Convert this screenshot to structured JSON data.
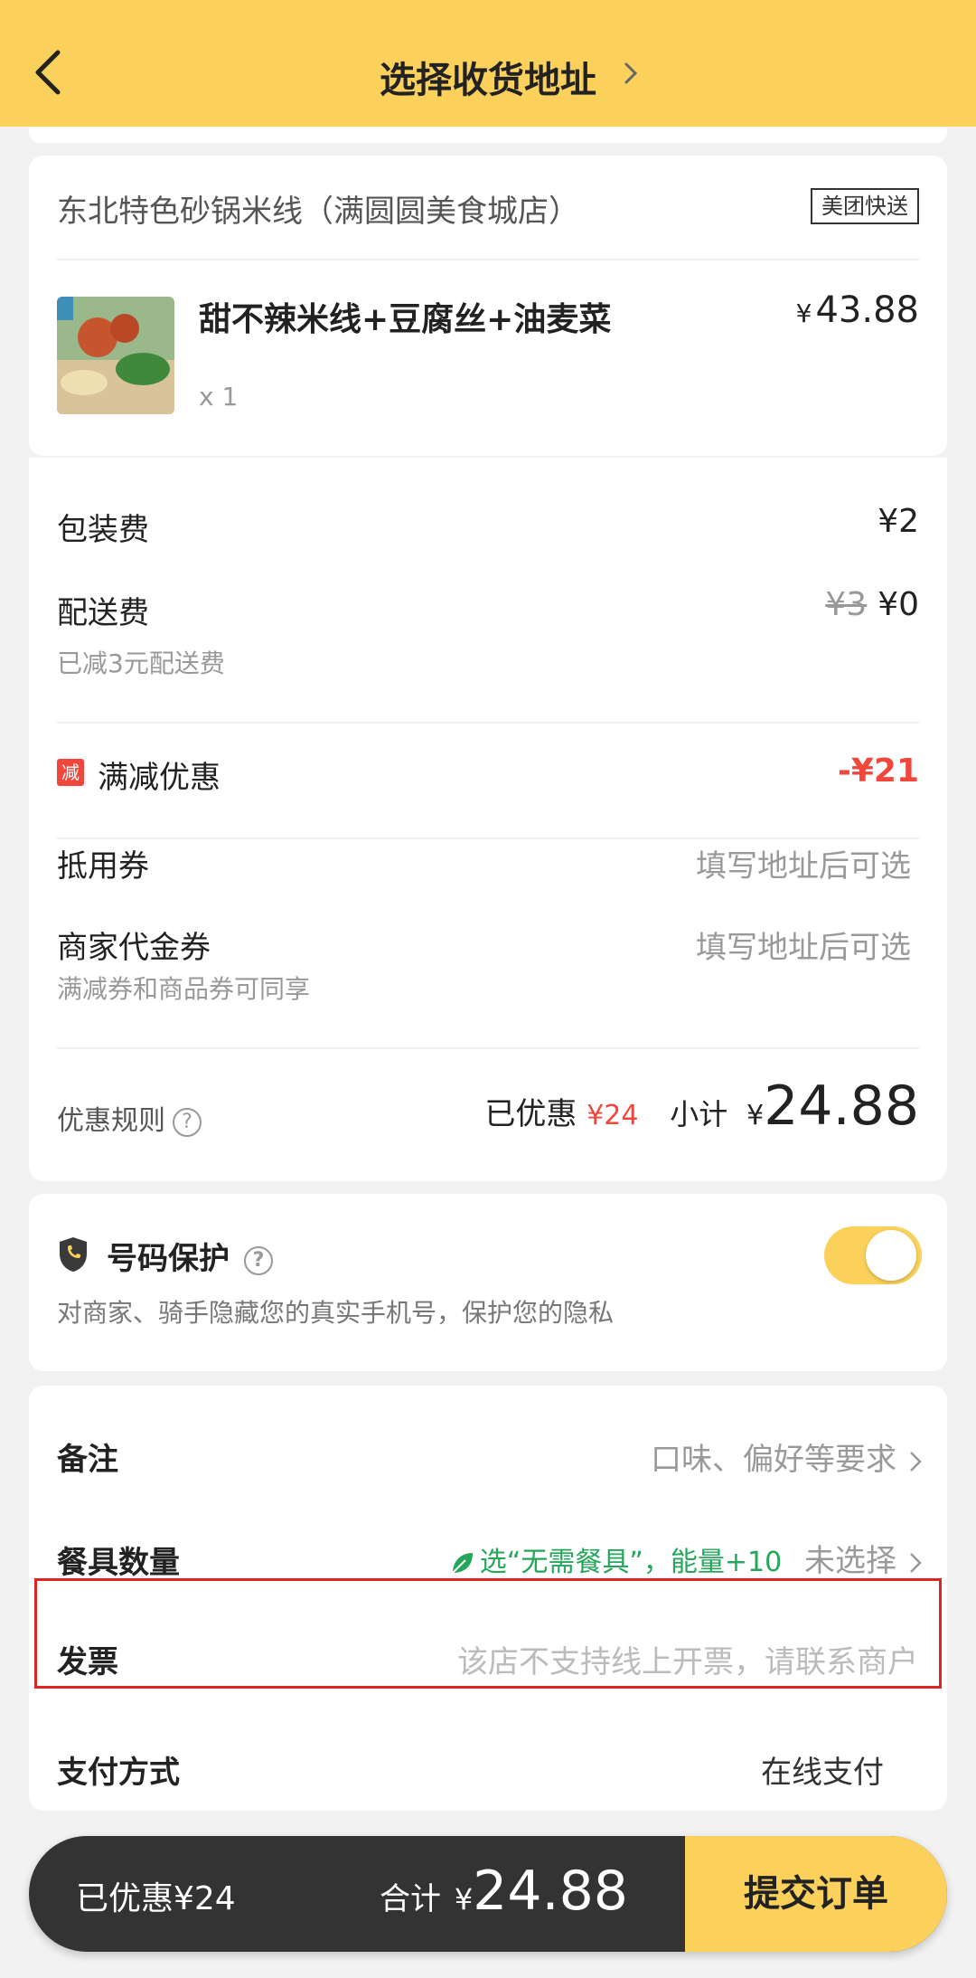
{
  "header": {
    "title": "选择收货地址"
  },
  "shop": {
    "name": "东北特色砂锅米线（满圆圆美食城店）",
    "badge": "美团快送",
    "item": {
      "name": "甜不辣米线+豆腐丝+油麦菜",
      "price_symbol": "¥",
      "price": "43.88",
      "qty": "x 1"
    }
  },
  "fees": {
    "packaging_label": "包装费",
    "packaging_value": "¥2",
    "delivery_label": "配送费",
    "delivery_original": "¥3",
    "delivery_value": "¥0",
    "delivery_note": "已减3元配送费",
    "discount_badge": "减",
    "discount_label": "满减优惠",
    "discount_value": "-¥21",
    "coupon_label": "抵用券",
    "coupon_value": "填写地址后可选",
    "voucher_label": "商家代金券",
    "voucher_value": "填写地址后可选",
    "voucher_note": "满减券和商品券可同享",
    "rules_label": "优惠规则",
    "saved_label": "已优惠",
    "saved_value": "¥24",
    "subtotal_label": "小计",
    "subtotal_symbol": "¥",
    "subtotal_value": "24.88"
  },
  "privacy": {
    "title": "号码保护",
    "desc": "对商家、骑手隐藏您的真实手机号，保护您的隐私",
    "toggle_on": true
  },
  "options": {
    "remark_label": "备注",
    "remark_value": "口味、偏好等要求",
    "utensils_label": "餐具数量",
    "utensils_promo": "选“无需餐具”，能量+10",
    "utensils_value": "未选择",
    "invoice_label": "发票",
    "invoice_value": "该店不支持线上开票，请联系商户",
    "payment_label": "支付方式",
    "payment_value": "在线支付"
  },
  "bottom": {
    "discount": "已优惠¥24",
    "total_label": "合计",
    "total_symbol": "¥",
    "total_value": "24.88",
    "submit": "提交订单"
  },
  "colors": {
    "accent": "#fbd15c",
    "red": "#f0463c",
    "green": "#26a65b",
    "highlight": "#e02424"
  }
}
